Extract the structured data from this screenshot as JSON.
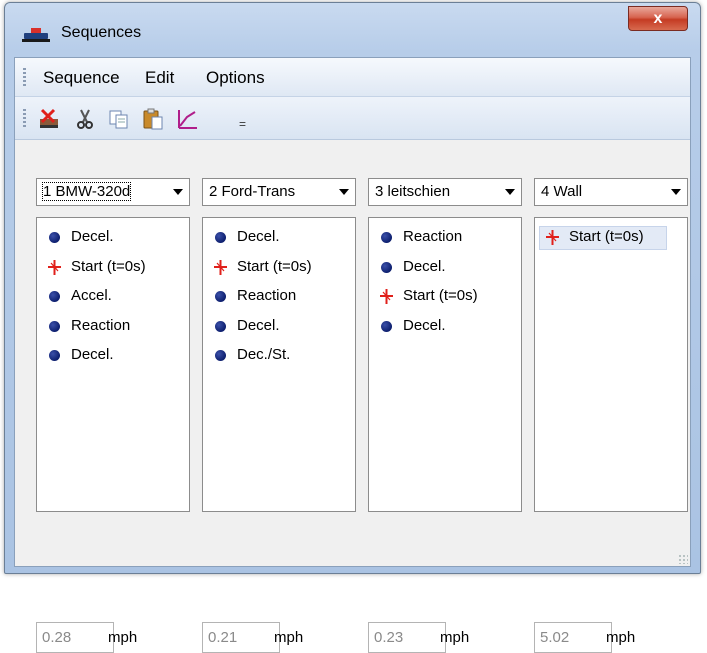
{
  "window": {
    "title": "Sequences",
    "close_label": "x"
  },
  "menu": {
    "items": [
      "Sequence",
      "Edit",
      "Options"
    ]
  },
  "toolbar": {
    "buttons": [
      "delete-icon",
      "scissors-icon",
      "copy-icon",
      "paste-icon",
      "chart-icon"
    ],
    "overflow": "="
  },
  "panels": [
    {
      "vehicle": "1 BMW-320d",
      "focused": true,
      "items": [
        {
          "type": "phase",
          "label": "Decel."
        },
        {
          "type": "start",
          "label": "Start (t=0s)"
        },
        {
          "type": "phase",
          "label": "Accel."
        },
        {
          "type": "phase",
          "label": "Reaction"
        },
        {
          "type": "phase",
          "label": "Decel."
        }
      ],
      "speed": "0.28",
      "unit": "mph"
    },
    {
      "vehicle": "2 Ford-Trans",
      "focused": false,
      "items": [
        {
          "type": "phase",
          "label": "Decel."
        },
        {
          "type": "start",
          "label": "Start (t=0s)"
        },
        {
          "type": "phase",
          "label": "Reaction"
        },
        {
          "type": "phase",
          "label": "Decel."
        },
        {
          "type": "phase",
          "label": "Dec./St."
        }
      ],
      "speed": "0.21",
      "unit": "mph"
    },
    {
      "vehicle": "3 leitschien",
      "focused": false,
      "items": [
        {
          "type": "phase",
          "label": "Reaction"
        },
        {
          "type": "phase",
          "label": "Decel."
        },
        {
          "type": "start",
          "label": "Start (t=0s)"
        },
        {
          "type": "phase",
          "label": "Decel."
        }
      ],
      "speed": "0.23",
      "unit": "mph"
    },
    {
      "vehicle": "4 Wall",
      "focused": false,
      "items": [
        {
          "type": "start",
          "label": "Start (t=0s)",
          "selected": true
        }
      ],
      "speed": "5.02",
      "unit": "mph"
    }
  ],
  "colors": {
    "phase_dot": "#0d1f6e",
    "start_marker": "#e0201b",
    "close_button": "#c43b23"
  }
}
